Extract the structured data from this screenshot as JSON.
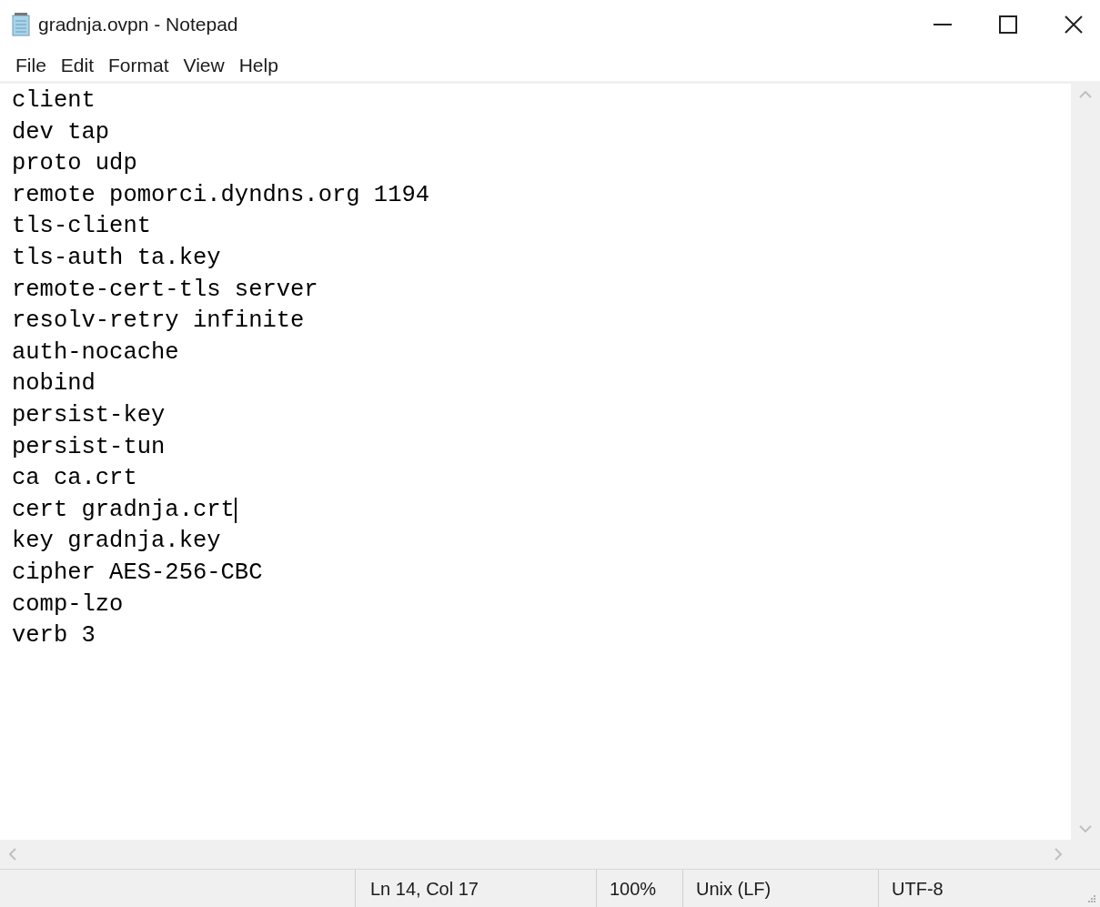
{
  "window": {
    "title": "gradnja.ovpn - Notepad"
  },
  "menu": [
    "File",
    "Edit",
    "Format",
    "View",
    "Help"
  ],
  "editor": {
    "lines": [
      {
        "text": "client",
        "caret": false
      },
      {
        "text": "dev tap",
        "caret": false
      },
      {
        "text": "proto udp",
        "caret": false
      },
      {
        "text": "remote pomorci.dyndns.org 1194",
        "caret": false
      },
      {
        "text": "tls-client",
        "caret": false
      },
      {
        "text": "tls-auth ta.key",
        "caret": false
      },
      {
        "text": "remote-cert-tls server",
        "caret": false
      },
      {
        "text": "resolv-retry infinite",
        "caret": false
      },
      {
        "text": "auth-nocache",
        "caret": false
      },
      {
        "text": "nobind",
        "caret": false
      },
      {
        "text": "persist-key",
        "caret": false
      },
      {
        "text": "persist-tun",
        "caret": false
      },
      {
        "text": "ca ca.crt",
        "caret": false
      },
      {
        "text": "cert gradnja.crt",
        "caret": true
      },
      {
        "text": "key gradnja.key",
        "caret": false
      },
      {
        "text": "cipher AES-256-CBC",
        "caret": false
      },
      {
        "text": "comp-lzo",
        "caret": false
      },
      {
        "text": "verb 3",
        "caret": false
      }
    ]
  },
  "status_bar": {
    "position": "Ln 14, Col 17",
    "zoom": "100%",
    "line_endings": "Unix (LF)",
    "encoding": "UTF-8"
  }
}
